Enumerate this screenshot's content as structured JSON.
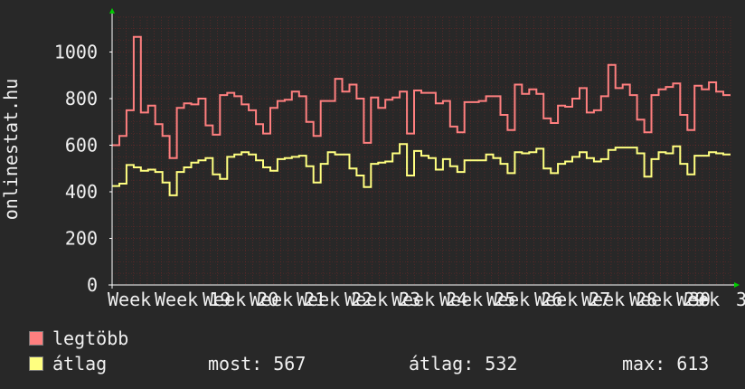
{
  "chart_data": {
    "type": "line",
    "ylabel": "onlinestat.hu",
    "ylim": [
      0,
      1150
    ],
    "yticks": [
      0,
      200,
      400,
      600,
      800,
      1000
    ],
    "xtick_labels": [
      "Week",
      "Week 19",
      "Week 20",
      "Week 21",
      "Week 22",
      "Week 23",
      "Week 24",
      "Week 25",
      "Week 26",
      "Week 27",
      "Week 28",
      "Week 29",
      "Week",
      "30",
      "3"
    ],
    "series": [
      {
        "name": "legtöbb",
        "color": "#ff7f7f",
        "values": [
          600,
          640,
          750,
          1065,
          740,
          770,
          690,
          640,
          545,
          760,
          780,
          775,
          800,
          685,
          645,
          815,
          825,
          810,
          775,
          750,
          690,
          650,
          760,
          790,
          795,
          830,
          810,
          700,
          640,
          790,
          790,
          885,
          830,
          860,
          800,
          610,
          805,
          760,
          795,
          805,
          830,
          650,
          835,
          825,
          825,
          780,
          790,
          680,
          655,
          785,
          785,
          790,
          810,
          810,
          730,
          665,
          860,
          820,
          840,
          820,
          715,
          695,
          770,
          765,
          800,
          845,
          740,
          750,
          810,
          945,
          845,
          860,
          815,
          710,
          655,
          815,
          840,
          850,
          865,
          730,
          665,
          855,
          840,
          870,
          830,
          815
        ]
      },
      {
        "name": "átlag",
        "color": "#ffff80",
        "values": [
          425,
          435,
          515,
          505,
          490,
          495,
          485,
          440,
          385,
          485,
          505,
          525,
          535,
          545,
          475,
          455,
          550,
          560,
          570,
          560,
          535,
          505,
          490,
          540,
          545,
          550,
          555,
          510,
          440,
          520,
          570,
          560,
          560,
          500,
          470,
          420,
          520,
          525,
          530,
          565,
          605,
          470,
          575,
          555,
          545,
          495,
          540,
          510,
          485,
          535,
          535,
          535,
          560,
          545,
          520,
          480,
          570,
          565,
          570,
          585,
          500,
          480,
          520,
          530,
          550,
          570,
          545,
          530,
          540,
          580,
          590,
          590,
          590,
          565,
          465,
          540,
          570,
          565,
          595,
          520,
          475,
          555,
          555,
          570,
          565,
          560
        ]
      }
    ],
    "legend": [
      {
        "label": "legtöbb",
        "color": "#ff7f7f"
      },
      {
        "label": "átlag",
        "color": "#ffff80"
      }
    ],
    "stats": {
      "most": "most: 567",
      "atlag": "átlag: 532",
      "max": "max: 613"
    },
    "grid": true,
    "grid_color": "#8b2a2a",
    "axis_color": "#ffffff"
  }
}
